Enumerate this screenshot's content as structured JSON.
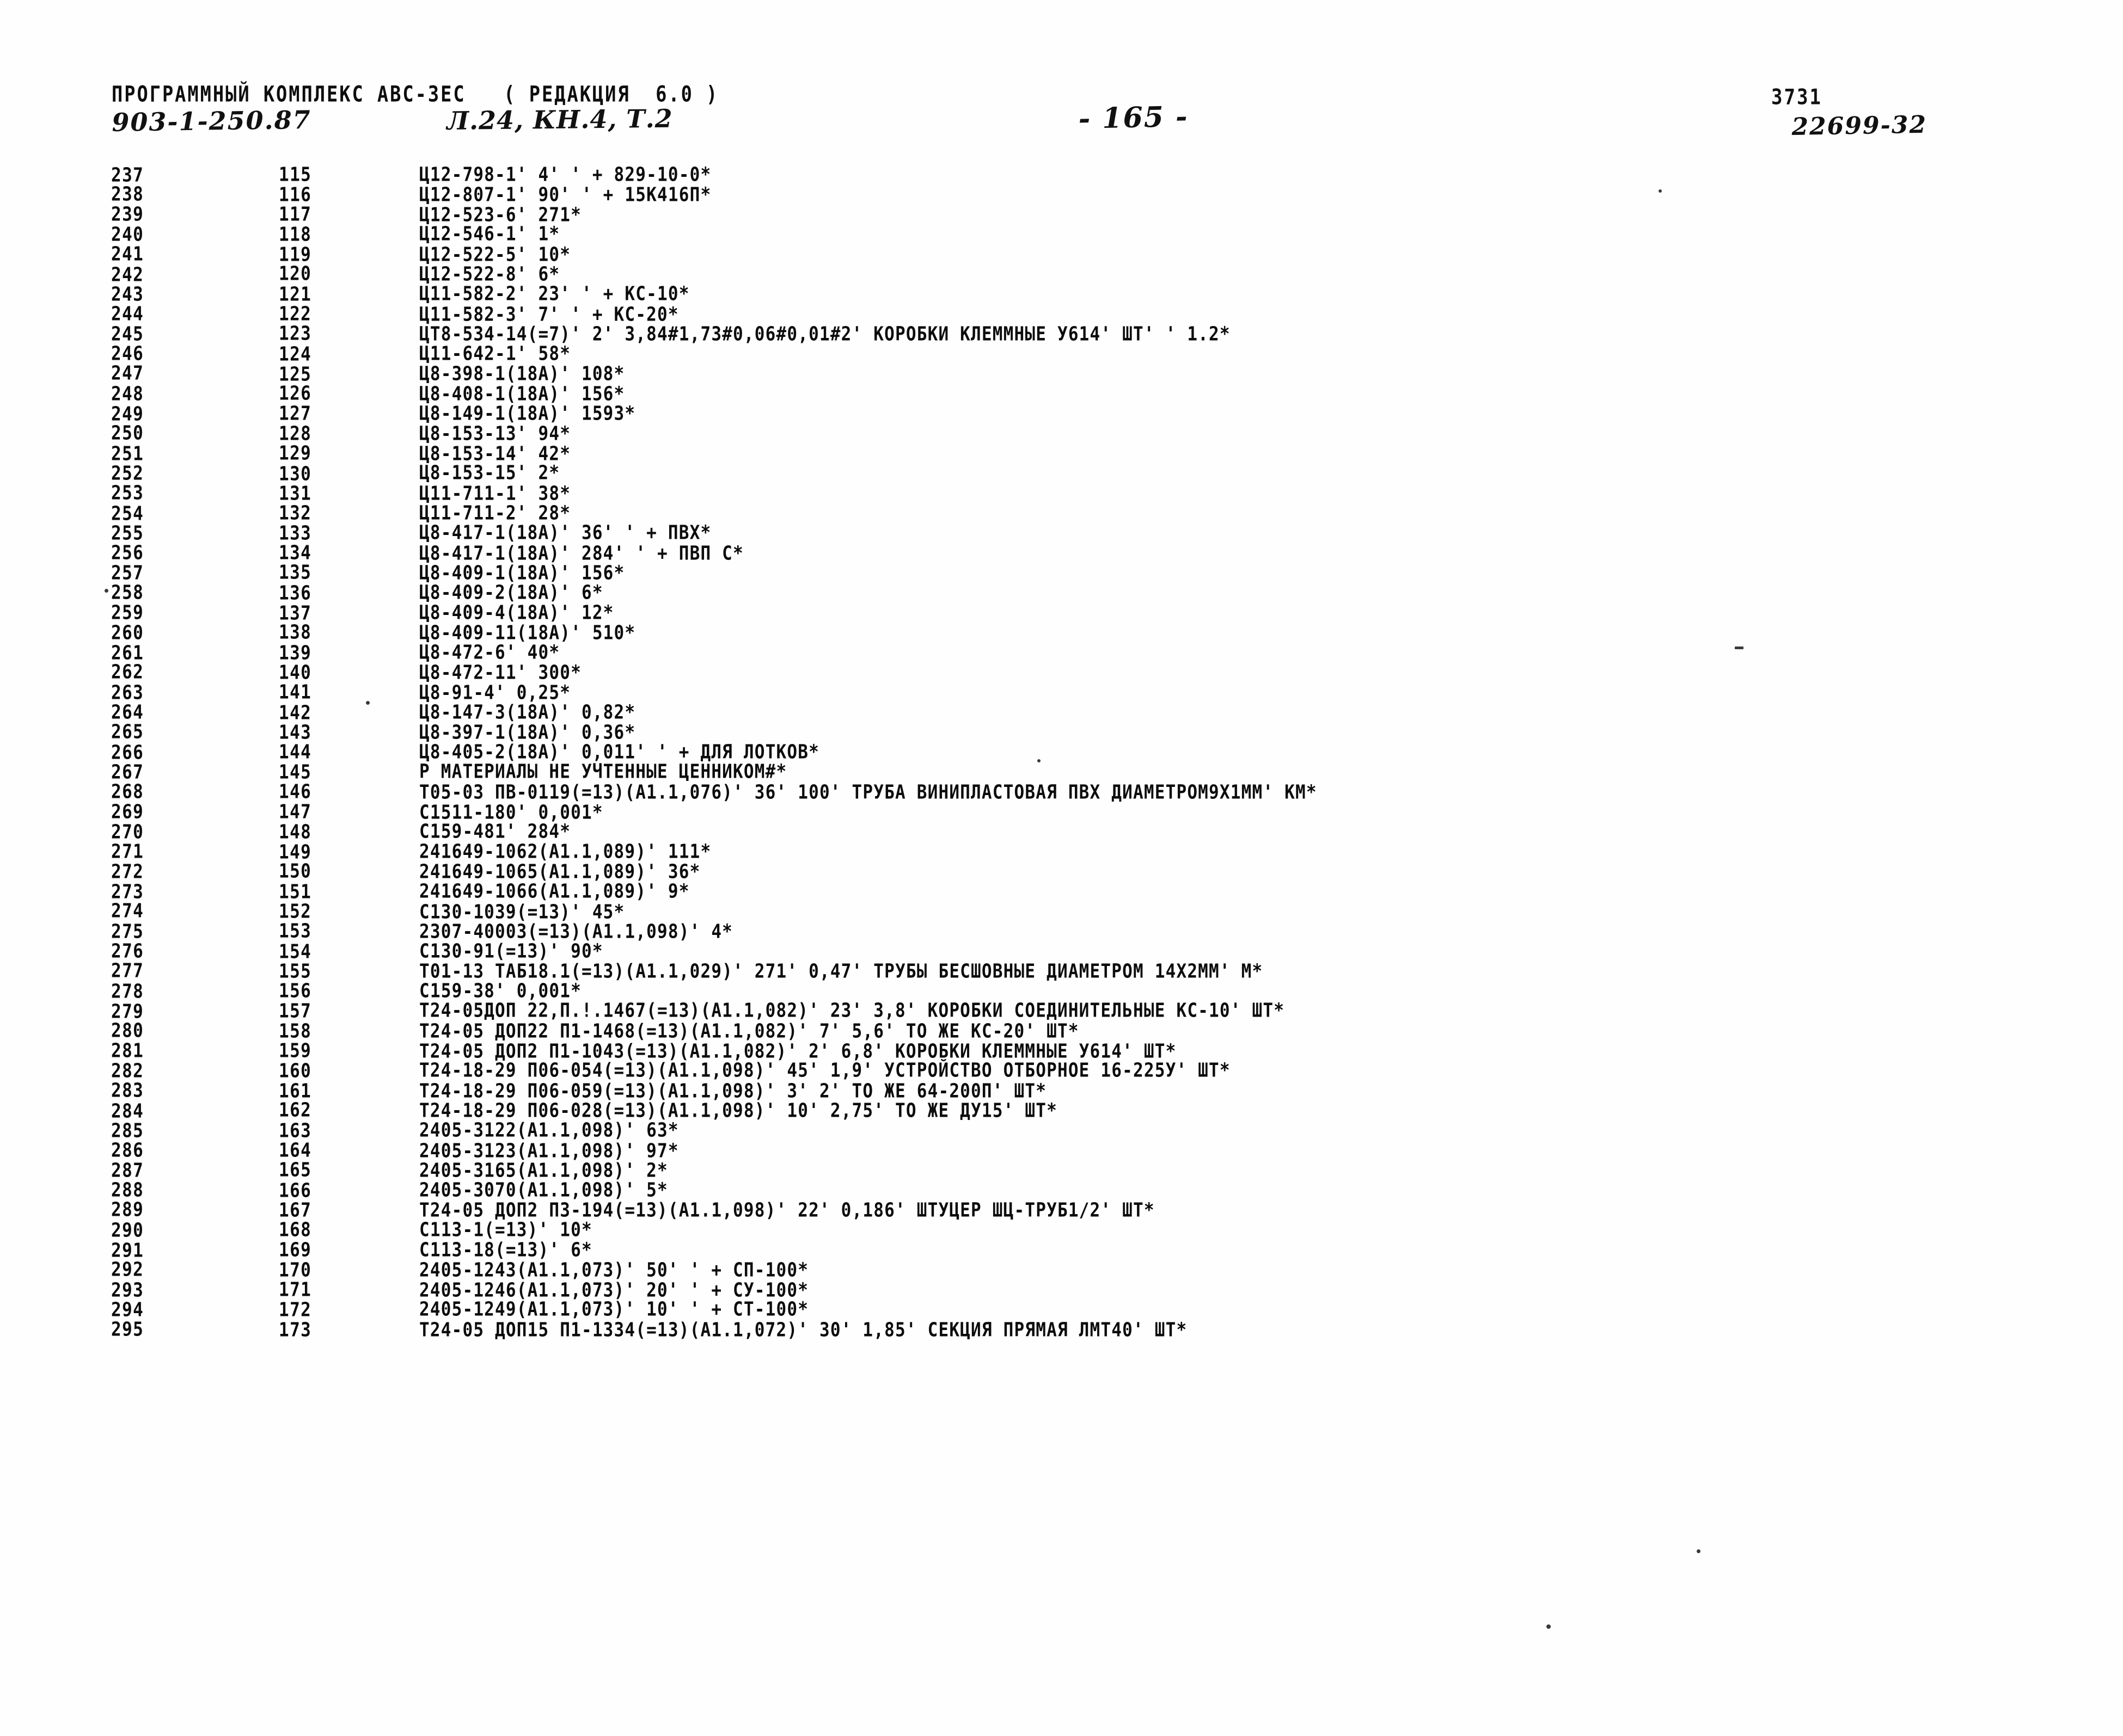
{
  "document": {
    "program_header": "ПРОГРАММНЫЙ КОМПЛЕКС ABC-3EC   ( РЕДАКЦИЯ  6.0 )",
    "doc_code": "903-1-250.87",
    "doc_subtitle": "Л.24, КН.4, Т.2",
    "page_marker": "- 165 -",
    "doc_number": "3731",
    "archive_number": "22699-32"
  },
  "listing": {
    "columns": [
      "seq",
      "index",
      "text"
    ],
    "rows": [
      {
        "seq": "237",
        "index": "115",
        "text": "Ц12-798-1' 4' ' + 829-10-0*"
      },
      {
        "seq": "238",
        "index": "116",
        "text": "Ц12-807-1' 90' ' + 15К416П*"
      },
      {
        "seq": "239",
        "index": "117",
        "text": "Ц12-523-6' 271*"
      },
      {
        "seq": "240",
        "index": "118",
        "text": "Ц12-546-1' 1*"
      },
      {
        "seq": "241",
        "index": "119",
        "text": "Ц12-522-5' 10*"
      },
      {
        "seq": "242",
        "index": "120",
        "text": "Ц12-522-8' 6*"
      },
      {
        "seq": "243",
        "index": "121",
        "text": "Ц11-582-2' 23' ' + КС-10*"
      },
      {
        "seq": "244",
        "index": "122",
        "text": "Ц11-582-3' 7' ' + КС-20*"
      },
      {
        "seq": "245",
        "index": "123",
        "text": "ЦТ8-534-14(=7)' 2' 3,84#1,73#0,06#0,01#2' КОРОБКИ КЛЕММНЫЕ У614' ШТ' ' 1.2*"
      },
      {
        "seq": "246",
        "index": "124",
        "text": "Ц11-642-1' 58*"
      },
      {
        "seq": "247",
        "index": "125",
        "text": "Ц8-398-1(18А)' 108*"
      },
      {
        "seq": "248",
        "index": "126",
        "text": "Ц8-408-1(18А)' 156*"
      },
      {
        "seq": "249",
        "index": "127",
        "text": "Ц8-149-1(18А)' 1593*"
      },
      {
        "seq": "250",
        "index": "128",
        "text": "Ц8-153-13' 94*"
      },
      {
        "seq": "251",
        "index": "129",
        "text": "Ц8-153-14' 42*"
      },
      {
        "seq": "252",
        "index": "130",
        "text": "Ц8-153-15' 2*"
      },
      {
        "seq": "253",
        "index": "131",
        "text": "Ц11-711-1' 38*"
      },
      {
        "seq": "254",
        "index": "132",
        "text": "Ц11-711-2' 28*"
      },
      {
        "seq": "255",
        "index": "133",
        "text": "Ц8-417-1(18А)' 36' ' + ПВХ*"
      },
      {
        "seq": "256",
        "index": "134",
        "text": "Ц8-417-1(18А)' 284' ' + ПВП С*"
      },
      {
        "seq": "257",
        "index": "135",
        "text": "Ц8-409-1(18А)' 156*"
      },
      {
        "seq": "258",
        "index": "136",
        "text": "Ц8-409-2(18А)' 6*"
      },
      {
        "seq": "259",
        "index": "137",
        "text": "Ц8-409-4(18А)' 12*"
      },
      {
        "seq": "260",
        "index": "138",
        "text": "Ц8-409-11(18А)' 510*"
      },
      {
        "seq": "261",
        "index": "139",
        "text": "Ц8-472-6' 40*"
      },
      {
        "seq": "262",
        "index": "140",
        "text": "Ц8-472-11' 300*"
      },
      {
        "seq": "263",
        "index": "141",
        "text": "Ц8-91-4' 0,25*"
      },
      {
        "seq": "264",
        "index": "142",
        "text": "Ц8-147-3(18А)' 0,82*"
      },
      {
        "seq": "265",
        "index": "143",
        "text": "Ц8-397-1(18А)' 0,36*"
      },
      {
        "seq": "266",
        "index": "144",
        "text": "Ц8-405-2(18А)' 0,011' ' + ДЛЯ ЛОТКОВ*"
      },
      {
        "seq": "267",
        "index": "145",
        "text": "Р МАТЕРИАЛЫ НЕ УЧТЕННЫЕ ЦЕННИКОМ#*"
      },
      {
        "seq": "268",
        "index": "146",
        "text": "Т05-03 ПВ-0119(=13)(А1.1,076)' 36' 100' ТРУБА ВИНИПЛАСТОВАЯ ПВХ ДИАМЕТРОМ9Х1ММ' КМ*"
      },
      {
        "seq": "269",
        "index": "147",
        "text": "С1511-180' 0,001*"
      },
      {
        "seq": "270",
        "index": "148",
        "text": "С159-481' 284*"
      },
      {
        "seq": "271",
        "index": "149",
        "text": "241649-1062(А1.1,089)' 111*"
      },
      {
        "seq": "272",
        "index": "150",
        "text": "241649-1065(А1.1,089)' 36*"
      },
      {
        "seq": "273",
        "index": "151",
        "text": "241649-1066(А1.1,089)' 9*"
      },
      {
        "seq": "274",
        "index": "152",
        "text": "С130-1039(=13)' 45*"
      },
      {
        "seq": "275",
        "index": "153",
        "text": "2307-40003(=13)(А1.1,098)' 4*"
      },
      {
        "seq": "276",
        "index": "154",
        "text": "С130-91(=13)' 90*"
      },
      {
        "seq": "277",
        "index": "155",
        "text": "Т01-13 ТАБ18.1(=13)(А1.1,029)' 271' 0,47' ТРУБЫ БЕСШОВНЫЕ ДИАМЕТРОМ 14Х2ММ' М*"
      },
      {
        "seq": "278",
        "index": "156",
        "text": "С159-38' 0,001*"
      },
      {
        "seq": "279",
        "index": "157",
        "text": "Т24-05ДОП 22,П.!.1467(=13)(А1.1,082)' 23' 3,8' КОРОБКИ СОЕДИНИТЕЛЬНЫЕ КС-10' ШТ*"
      },
      {
        "seq": "280",
        "index": "158",
        "text": "Т24-05 ДОП22 П1-1468(=13)(А1.1,082)' 7' 5,6' ТО ЖЕ КС-20' ШТ*"
      },
      {
        "seq": "281",
        "index": "159",
        "text": "Т24-05 ДОП2 П1-1043(=13)(А1.1,082)' 2' 6,8' КОРОБКИ КЛЕММНЫЕ У614' ШТ*"
      },
      {
        "seq": "282",
        "index": "160",
        "text": "Т24-18-29 П06-054(=13)(А1.1,098)' 45' 1,9' УСТРОЙСТВО ОТБОРНОЕ 16-225У' ШТ*"
      },
      {
        "seq": "283",
        "index": "161",
        "text": "Т24-18-29 П06-059(=13)(А1.1,098)' 3' 2' ТО ЖЕ 64-200П' ШТ*"
      },
      {
        "seq": "284",
        "index": "162",
        "text": "Т24-18-29 П06-028(=13)(А1.1,098)' 10' 2,75' ТО ЖЕ ДУ15' ШТ*"
      },
      {
        "seq": "285",
        "index": "163",
        "text": "2405-3122(А1.1,098)' 63*"
      },
      {
        "seq": "286",
        "index": "164",
        "text": "2405-3123(А1.1,098)' 97*"
      },
      {
        "seq": "287",
        "index": "165",
        "text": "2405-3165(А1.1,098)' 2*"
      },
      {
        "seq": "288",
        "index": "166",
        "text": "2405-3070(А1.1,098)' 5*"
      },
      {
        "seq": "289",
        "index": "167",
        "text": "Т24-05 ДОП2 П3-194(=13)(А1.1,098)' 22' 0,186' ШТУЦЕР ШЦ-ТРУБ1/2' ШТ*"
      },
      {
        "seq": "290",
        "index": "168",
        "text": "С113-1(=13)' 10*"
      },
      {
        "seq": "291",
        "index": "169",
        "text": "С113-18(=13)' 6*"
      },
      {
        "seq": "292",
        "index": "170",
        "text": "2405-1243(А1.1,073)' 50' ' + СП-100*"
      },
      {
        "seq": "293",
        "index": "171",
        "text": "2405-1246(А1.1,073)' 20' ' + СУ-100*"
      },
      {
        "seq": "294",
        "index": "172",
        "text": "2405-1249(А1.1,073)' 10' ' + СТ-100*"
      },
      {
        "seq": "295",
        "index": "173",
        "text": "Т24-05 ДОП15 П1-1334(=13)(А1.1,072)' 30' 1,85' СЕКЦИЯ ПРЯМАЯ ЛМТ40' ШТ*"
      }
    ]
  }
}
